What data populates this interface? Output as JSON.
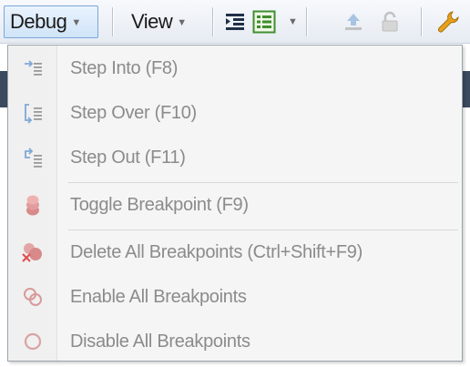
{
  "toolbar": {
    "debug_label": "Debug",
    "view_label": "View",
    "icons": [
      "indent-icon",
      "list-view-icon",
      "upload-icon",
      "unlock-icon",
      "wrench-icon"
    ]
  },
  "menu": {
    "items": [
      {
        "label": "Step Into (F8)",
        "icon": "step-into-icon",
        "enabled": false
      },
      {
        "label": "Step Over (F10)",
        "icon": "step-over-icon",
        "enabled": false
      },
      {
        "label": "Step Out (F11)",
        "icon": "step-out-icon",
        "enabled": false
      },
      {
        "label": "Toggle Breakpoint (F9)",
        "icon": "toggle-breakpoint-icon",
        "enabled": false
      },
      {
        "label": "Delete All Breakpoints (Ctrl+Shift+F9)",
        "icon": "delete-breakpoints-icon",
        "enabled": false
      },
      {
        "label": "Enable All Breakpoints",
        "icon": "enable-breakpoints-icon",
        "enabled": false
      },
      {
        "label": "Disable All Breakpoints",
        "icon": "disable-breakpoints-icon",
        "enabled": false
      }
    ]
  },
  "colors": {
    "active_button_border": "#7aa7d9",
    "disabled_text": "#8b8b8b",
    "menu_background": "#f5f5f5"
  }
}
